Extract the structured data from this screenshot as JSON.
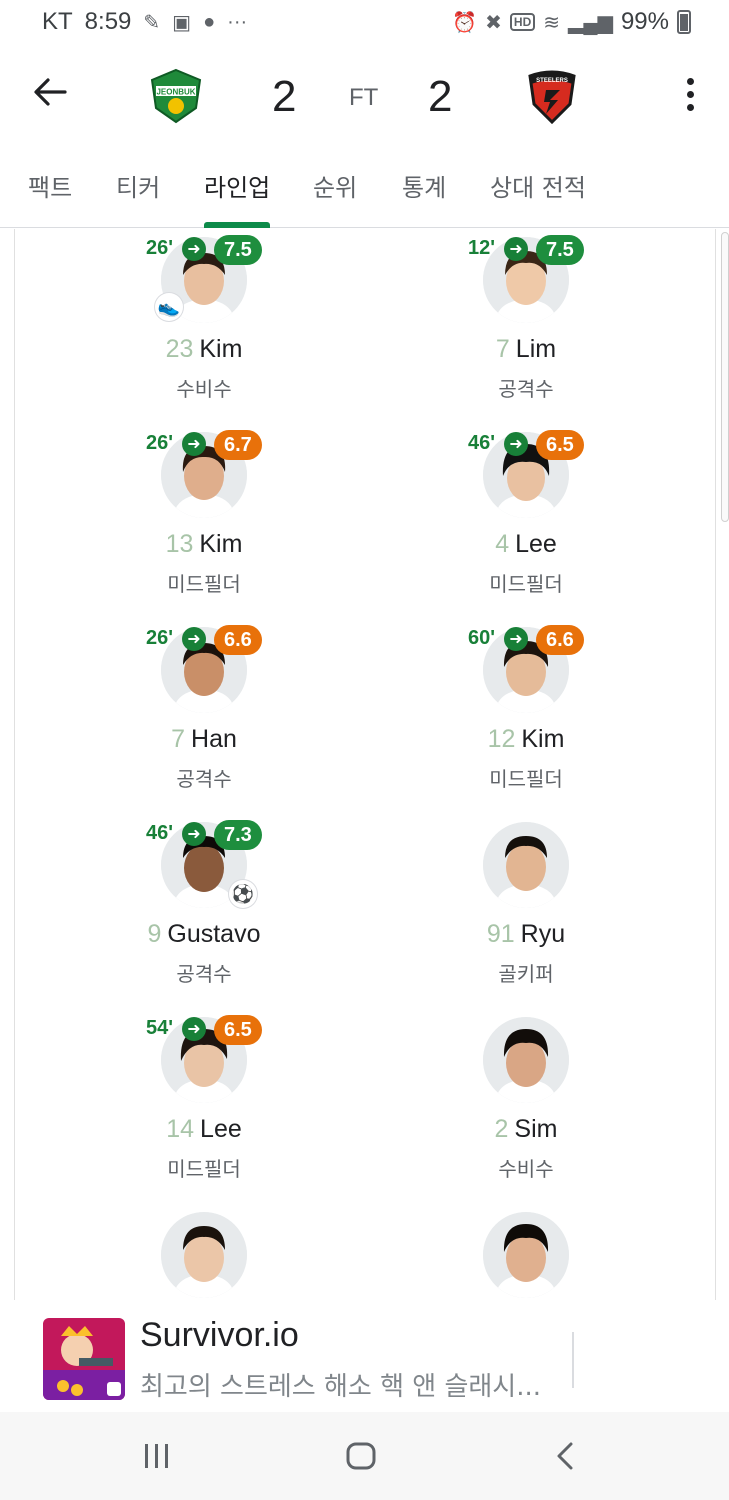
{
  "status_bar": {
    "carrier": "KT",
    "time": "8:59",
    "battery": "99%",
    "hd": "HD"
  },
  "header": {
    "home_team_logo": "JEONBUK",
    "away_team_logo": "STEELERS",
    "home_score": "2",
    "away_score": "2",
    "match_status": "FT"
  },
  "tabs": [
    {
      "label": "팩트"
    },
    {
      "label": "티커"
    },
    {
      "label": "라인업"
    },
    {
      "label": "순위"
    },
    {
      "label": "통계"
    },
    {
      "label": "상대 전적"
    }
  ],
  "lineup": {
    "home": [
      {
        "sub_time": "26'",
        "rating": "7.5",
        "rating_color": "#1e8e3e",
        "number": "23",
        "name": "Kim",
        "position": "수비수",
        "event": "boot-icon"
      },
      {
        "sub_time": "26'",
        "rating": "6.7",
        "rating_color": "#e8710a",
        "number": "13",
        "name": "Kim",
        "position": "미드필더"
      },
      {
        "sub_time": "26'",
        "rating": "6.6",
        "rating_color": "#e8710a",
        "number": "7",
        "name": "Han",
        "position": "공격수"
      },
      {
        "sub_time": "46'",
        "rating": "7.3",
        "rating_color": "#1e8e3e",
        "number": "9",
        "name": "Gustavo",
        "position": "공격수",
        "event": "goal-ball-icon"
      },
      {
        "sub_time": "54'",
        "rating": "6.5",
        "rating_color": "#e8710a",
        "number": "14",
        "name": "Lee",
        "position": "미드필더"
      },
      {
        "number": "",
        "name": "",
        "position": ""
      }
    ],
    "away": [
      {
        "sub_time": "12'",
        "rating": "7.5",
        "rating_color": "#1e8e3e",
        "number": "7",
        "name": "Lim",
        "position": "공격수"
      },
      {
        "sub_time": "46'",
        "rating": "6.5",
        "rating_color": "#e8710a",
        "number": "4",
        "name": "Lee",
        "position": "미드필더"
      },
      {
        "sub_time": "60'",
        "rating": "6.6",
        "rating_color": "#e8710a",
        "number": "12",
        "name": "Kim",
        "position": "미드필더"
      },
      {
        "number": "91",
        "name": "Ryu",
        "position": "골키퍼"
      },
      {
        "number": "2",
        "name": "Sim",
        "position": "수비수"
      },
      {
        "number": "",
        "name": "",
        "position": ""
      }
    ]
  },
  "ad": {
    "title": "Survivor.io",
    "subtitle": "최고의 스트레스 해소 핵 앤 슬래시..."
  },
  "colors": {
    "accent": "#0d8b4a",
    "rating_green": "#1e8e3e",
    "rating_orange": "#e8710a",
    "sub_green": "#188038"
  }
}
